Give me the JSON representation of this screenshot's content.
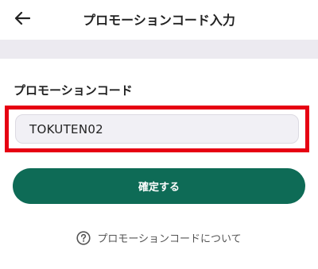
{
  "header": {
    "title": "プロモーションコード入力",
    "back_icon": "arrow-left-icon"
  },
  "form": {
    "label": "プロモーションコード",
    "input_value": "TOKUTEN02",
    "highlight_color": "#e60012"
  },
  "actions": {
    "confirm_label": "確定する",
    "accent_color": "#0e6b56"
  },
  "help": {
    "icon": "question-circle-icon",
    "text": "プロモーションコードについて"
  }
}
